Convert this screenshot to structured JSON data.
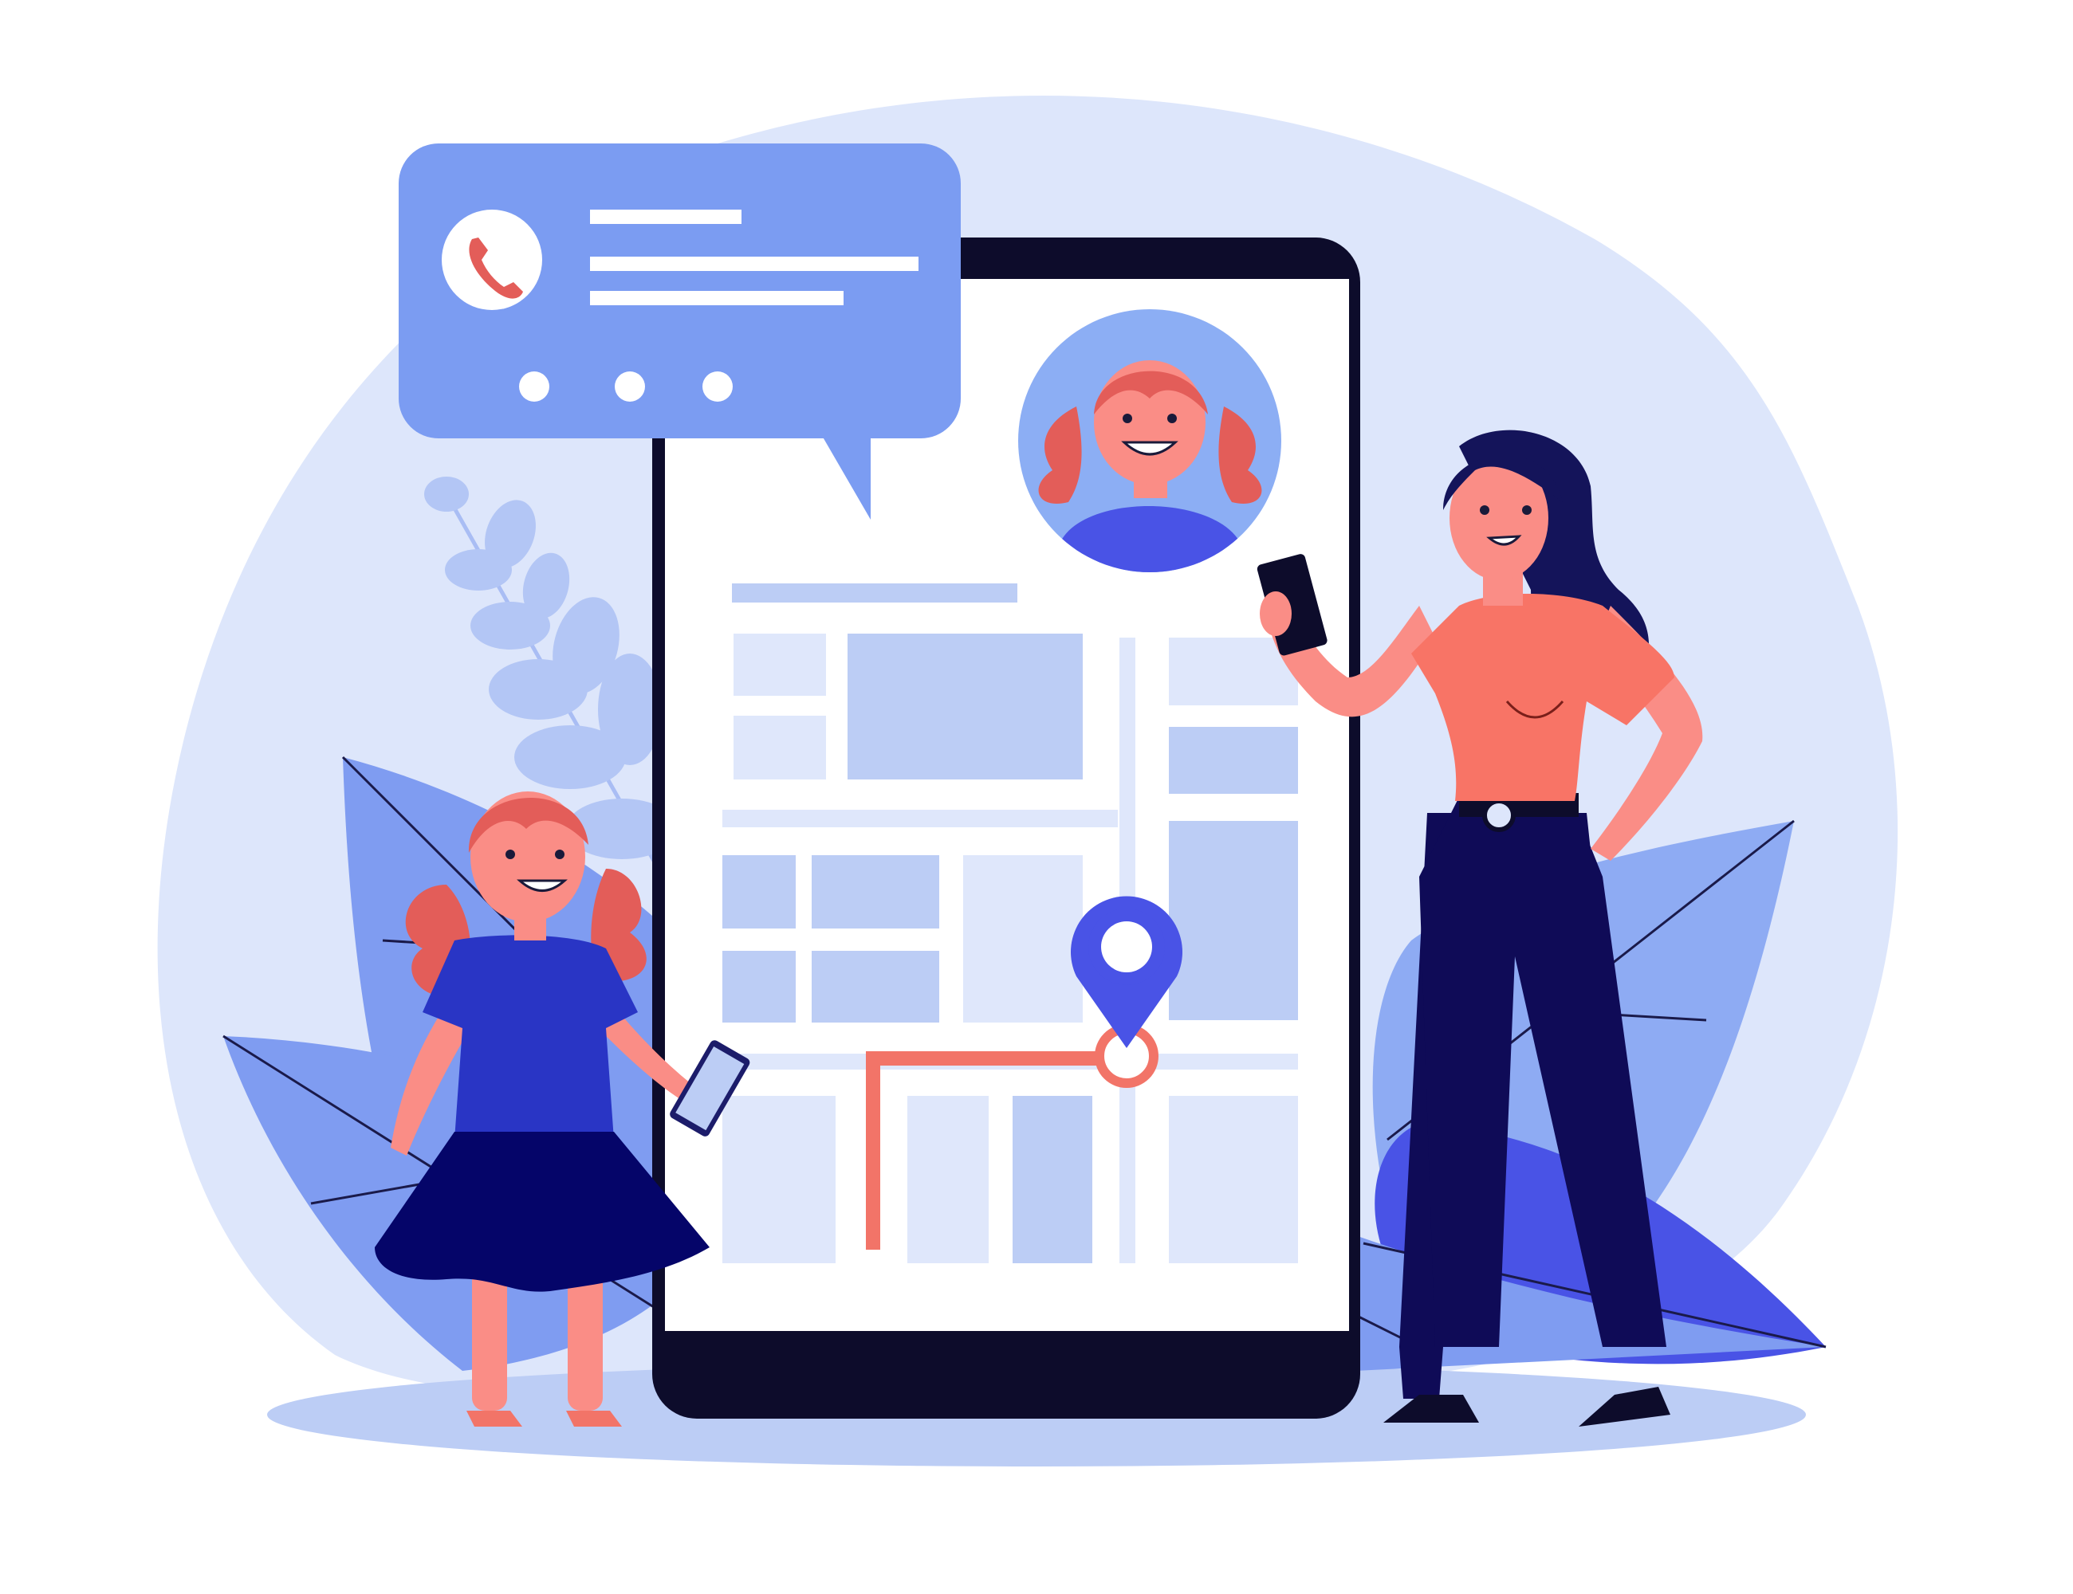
{
  "illustration": {
    "subject": "parent-tracking-child-location",
    "icons": {
      "call": "phone-icon",
      "location": "map-pin-icon",
      "avatar": "child-avatar"
    },
    "colors": {
      "background": "#ffffff",
      "blob": "#dde6fb",
      "ground": "#bccdf5",
      "bubble": "#7b9cf2",
      "phone_frame": "#0d0c2b",
      "map_block": "#bccdf5",
      "map_road": "#dfe7fb",
      "route": "#f27468",
      "pin": "#4953e6",
      "skin": "#fa8d86",
      "child_hair": "#e35d59",
      "woman_hair": "#14145a",
      "woman_top": "#f87466",
      "woman_pants": "#0f0b57",
      "girl_dress": "#2935c5",
      "girl_skirt": "#050569",
      "leaf_light": "#a9bdf4",
      "leaf_mid": "#7f9cf1",
      "leaf_dark": "#4953e6"
    }
  }
}
